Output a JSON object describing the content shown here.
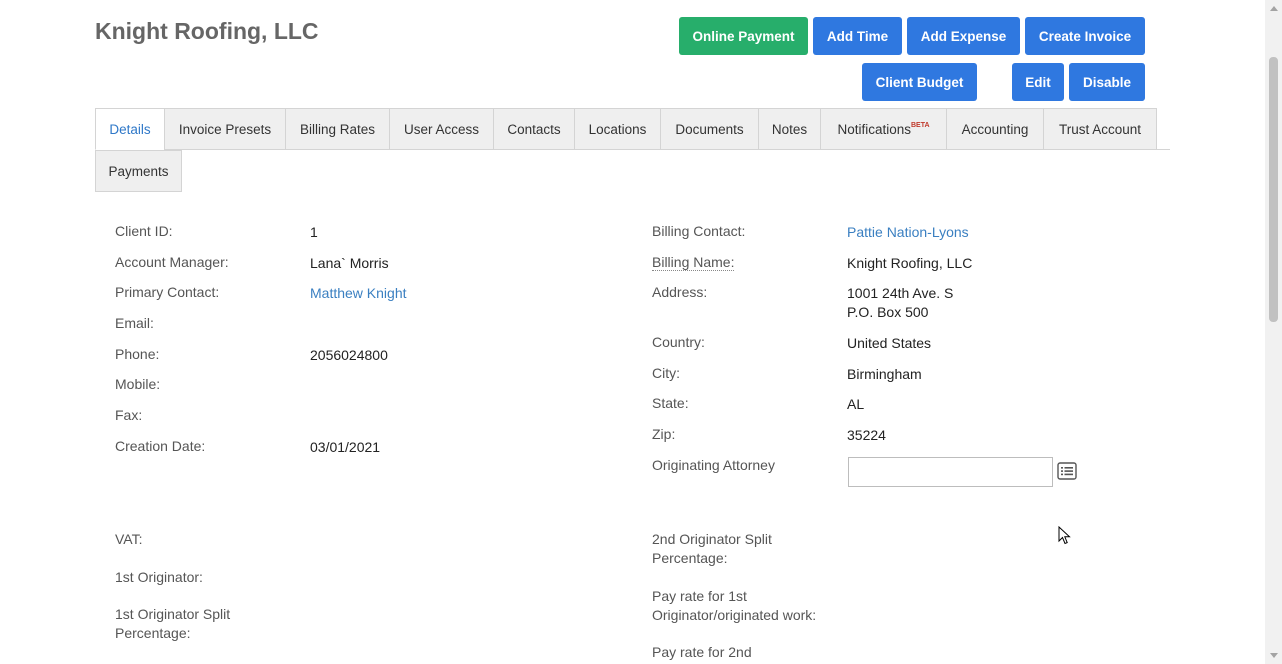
{
  "page_title": "Knight Roofing, LLC",
  "buttons": {
    "online_payment": "Online Payment",
    "add_time": "Add Time",
    "add_expense": "Add Expense",
    "create_invoice": "Create Invoice",
    "client_budget": "Client Budget",
    "edit": "Edit",
    "disable": "Disable"
  },
  "tabs": [
    {
      "label": "Details",
      "active": true
    },
    {
      "label": "Invoice Presets"
    },
    {
      "label": "Billing Rates"
    },
    {
      "label": "User Access"
    },
    {
      "label": "Contacts"
    },
    {
      "label": "Locations"
    },
    {
      "label": "Documents"
    },
    {
      "label": "Notes"
    },
    {
      "label": "Notifications",
      "badge": "BETA"
    },
    {
      "label": "Accounting"
    },
    {
      "label": "Trust Account"
    },
    {
      "label": "Payments"
    }
  ],
  "details_left": {
    "client_id_label": "Client ID:",
    "client_id": "1",
    "account_manager_label": "Account Manager:",
    "account_manager": "Lana` Morris",
    "primary_contact_label": "Primary Contact:",
    "primary_contact": "Matthew Knight",
    "email_label": "Email:",
    "phone_label": "Phone:",
    "phone": "2056024800",
    "mobile_label": "Mobile:",
    "fax_label": "Fax:",
    "creation_date_label": "Creation Date:",
    "creation_date": "03/01/2021",
    "vat_label": "VAT:",
    "first_originator_label": "1st Originator:",
    "first_split_label_1": "1st Originator Split",
    "first_split_label_2": "Percentage:"
  },
  "details_right": {
    "billing_contact_label": "Billing Contact:",
    "billing_contact": "Pattie Nation-Lyons",
    "billing_name_label": "Billing Name:",
    "billing_name": "Knight Roofing, LLC",
    "address_label": "Address:",
    "address_line1": "1001 24th Ave. S",
    "address_line2": "P.O. Box 500",
    "country_label": "Country:",
    "country": "United States",
    "city_label": "City:",
    "city": "Birmingham",
    "state_label": "State:",
    "state": "AL",
    "zip_label": "Zip:",
    "zip": "35224",
    "originating_attorney_label": "Originating Attorney",
    "originating_attorney_value": "",
    "second_split_label_1": "2nd Originator Split",
    "second_split_label_2": "Percentage:",
    "pay_rate_1_label_1": "Pay rate for 1st",
    "pay_rate_1_label_2": "Originator/originated work:",
    "pay_rate_2_label_1": "Pay rate for 2nd"
  },
  "colors": {
    "primary": "#2f78e0",
    "success": "#27ae6b",
    "link": "#3a7fc1"
  }
}
